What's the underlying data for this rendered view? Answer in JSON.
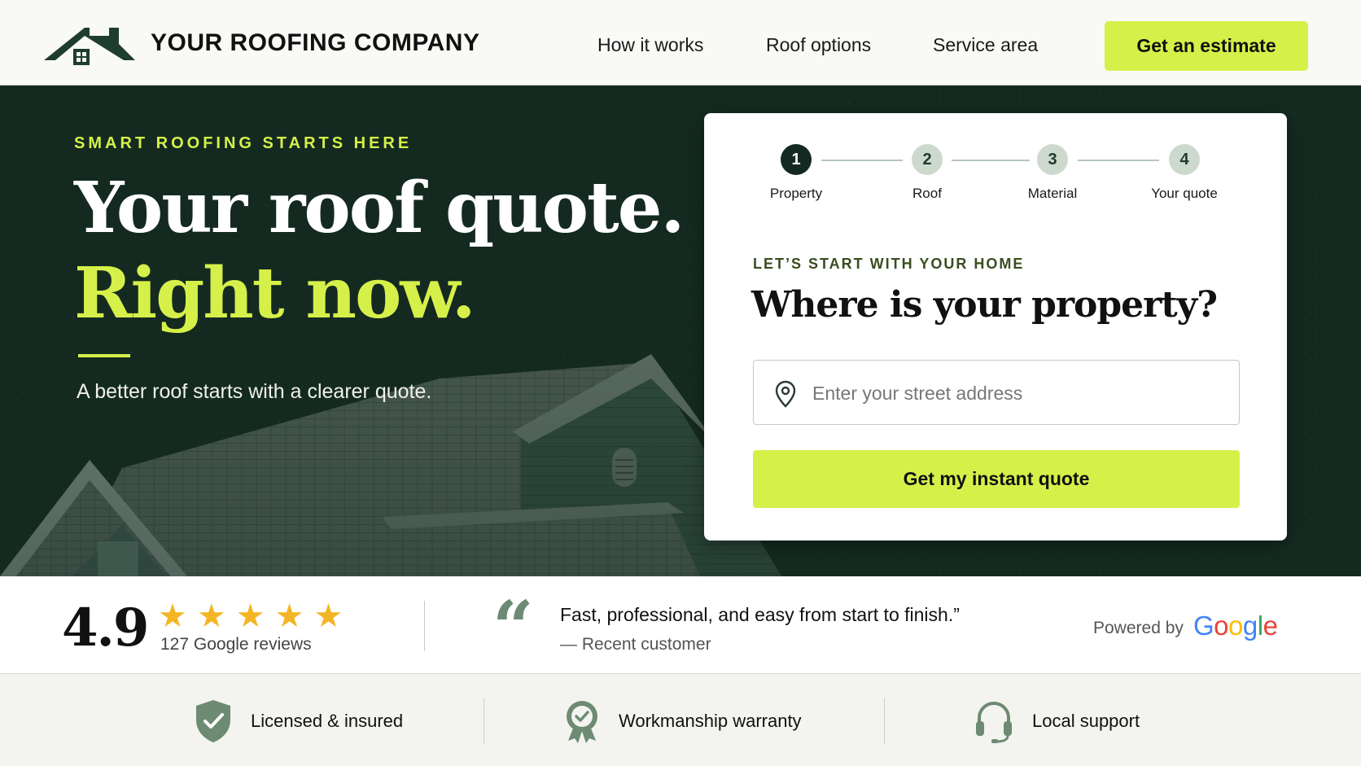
{
  "header": {
    "brand": "YOUR ROOFING COMPANY",
    "logo_icon": "house-roof-logo-icon",
    "nav": [
      {
        "label": "How it works"
      },
      {
        "label": "Roof options"
      },
      {
        "label": "Service area"
      }
    ],
    "cta_label": "Get an estimate"
  },
  "hero": {
    "eyebrow": "SMART ROOFING STARTS HERE",
    "headline_line1": "Your roof quote.",
    "headline_line2": "Right now.",
    "subtext": "A better roof starts with a clearer quote."
  },
  "quote_card": {
    "steps": [
      {
        "number": "1",
        "label": "Property",
        "active": true
      },
      {
        "number": "2",
        "label": "Roof",
        "active": false
      },
      {
        "number": "3",
        "label": "Material",
        "active": false
      },
      {
        "number": "4",
        "label": "Your quote",
        "active": false
      }
    ],
    "eyebrow": "LET’S START WITH YOUR HOME",
    "title": "Where is your property?",
    "address_placeholder": "Enter your street address",
    "address_value": "",
    "submit_label": "Get my instant quote"
  },
  "reviews": {
    "rating": "4.9",
    "stars": "★★★★★",
    "star_count": 5,
    "review_count": "127 Google reviews",
    "quote_mark": "“",
    "quote": "Fast, professional, and easy from start to finish.”",
    "author": "— Recent customer",
    "powered_by": "Powered by",
    "google_letters": [
      "G",
      "o",
      "o",
      "g",
      "l",
      "e"
    ]
  },
  "features": [
    {
      "label": "Licensed & insured",
      "icon": "shield-check-icon"
    },
    {
      "label": "Workmanship warranty",
      "icon": "award-badge-icon"
    },
    {
      "label": "Local support",
      "icon": "headset-icon"
    }
  ],
  "colors": {
    "accent": "#d6f04a",
    "dark_green": "#142a20",
    "muted_green": "#6d8b72",
    "star": "#f4b524",
    "google_blue": "#4285F4",
    "google_red": "#EA4335",
    "google_yellow": "#FBBC05",
    "google_green": "#34A853"
  }
}
